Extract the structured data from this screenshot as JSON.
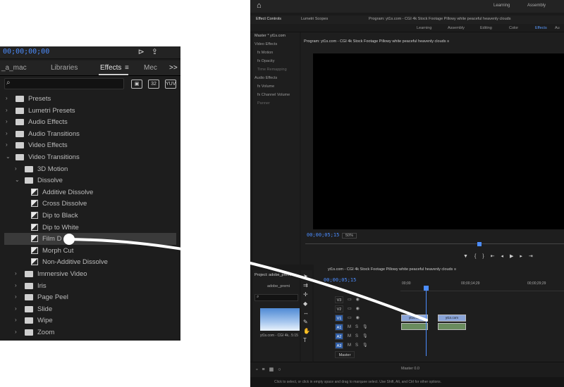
{
  "zoom_panel": {
    "timecode": "00;00;00;00",
    "top_icons": [
      "wrench-icon",
      "export-icon"
    ],
    "tabs": [
      {
        "label": "_a_mac",
        "active": false
      },
      {
        "label": "Libraries",
        "active": false
      },
      {
        "label": "Effects",
        "active": true
      },
      {
        "label": "Mec",
        "active": false
      }
    ],
    "tabs_overflow": ">>",
    "tab_menu": "≡",
    "search": {
      "value": "",
      "placeholder": ""
    },
    "badges": [
      "32",
      "YUV"
    ],
    "items": [
      {
        "label": "Presets",
        "type": "folder-special",
        "level": 0,
        "expanded": false
      },
      {
        "label": "Lumetri Presets",
        "type": "folder-special",
        "level": 0,
        "expanded": false
      },
      {
        "label": "Audio Effects",
        "type": "folder",
        "level": 0,
        "expanded": false
      },
      {
        "label": "Audio Transitions",
        "type": "folder",
        "level": 0,
        "expanded": false
      },
      {
        "label": "Video Effects",
        "type": "folder",
        "level": 0,
        "expanded": false
      },
      {
        "label": "Video Transitions",
        "type": "folder",
        "level": 0,
        "expanded": true
      },
      {
        "label": "3D Motion",
        "type": "folder",
        "level": 1,
        "expanded": false
      },
      {
        "label": "Dissolve",
        "type": "folder",
        "level": 1,
        "expanded": true
      },
      {
        "label": "Additive Dissolve",
        "type": "effect",
        "level": 2
      },
      {
        "label": "Cross Dissolve",
        "type": "effect",
        "level": 2
      },
      {
        "label": "Dip to Black",
        "type": "effect",
        "level": 2
      },
      {
        "label": "Dip to White",
        "type": "effect",
        "level": 2
      },
      {
        "label": "Film D",
        "type": "effect",
        "level": 2,
        "selected": true
      },
      {
        "label": "Morph Cut",
        "type": "effect",
        "level": 2
      },
      {
        "label": "Non-Additive Dissolve",
        "type": "effect",
        "level": 2
      },
      {
        "label": "Immersive Video",
        "type": "folder",
        "level": 1,
        "expanded": false
      },
      {
        "label": "Iris",
        "type": "folder",
        "level": 1,
        "expanded": false
      },
      {
        "label": "Page Peel",
        "type": "folder",
        "level": 1,
        "expanded": false
      },
      {
        "label": "Slide",
        "type": "folder",
        "level": 1,
        "expanded": false
      },
      {
        "label": "Wipe",
        "type": "folder",
        "level": 1,
        "expanded": false
      },
      {
        "label": "Zoom",
        "type": "folder",
        "level": 1,
        "expanded": false
      }
    ]
  },
  "premiere": {
    "title_links": [
      "Learning",
      "Assembly"
    ],
    "panel_tabs": [
      "Effect Controls",
      "Lumetri Scopes",
      "Program: yt1s.com - CGI 4k Stock Footage  Pillowy white peaceful heavenly clouds"
    ],
    "workspaces": [
      {
        "label": "Learning",
        "active": false
      },
      {
        "label": "Assembly",
        "active": false
      },
      {
        "label": "Editing",
        "active": false
      },
      {
        "label": "Color",
        "active": false
      },
      {
        "label": "Effects",
        "active": true
      },
      {
        "label": "Au",
        "active": false
      }
    ],
    "effect_controls": {
      "master": "Master * yt1s.com",
      "rows": [
        "Video Effects",
        "fx  Motion",
        "fx  Opacity",
        "Time Remapping",
        "Audio Effects",
        "fx  Volume",
        "fx  Channel Volume",
        "Panner"
      ]
    },
    "program": {
      "title": "Program: yt1s.com - CGI 4k Stock Footage  Pillowy white peaceful heavenly clouds  ≡",
      "timecode": "00;00;05;15",
      "zoom": "50%"
    },
    "project": {
      "title": "Project: adobe_premi",
      "file": "adobe_premi",
      "clip_label": "yt1s.com - CGI 4k.. 5:15"
    },
    "timeline": {
      "title": "yt1s.com - CGI 4k Stock Footage  Pillowy white peaceful heavenly clouds  ≡",
      "timecode": "00;00;05;15",
      "ruler": [
        "00;00",
        "00;00;14;29",
        "00;00;29;29"
      ],
      "tracks": [
        {
          "name": "V3",
          "on": false
        },
        {
          "name": "V2",
          "on": false
        },
        {
          "name": "V1",
          "on": true
        },
        {
          "name": "A1",
          "on": true
        },
        {
          "name": "A2",
          "on": true
        },
        {
          "name": "A3",
          "on": true
        },
        {
          "name": "Master",
          "on": false
        }
      ],
      "clip_label_video": "yt1s.com",
      "clip_label_audio": ""
    },
    "bottom_tabs": "Master     0.0",
    "status": "Click to select, or click in empty space and drag to marquee select. Use Shift, Alt, and Ctrl for other options."
  }
}
